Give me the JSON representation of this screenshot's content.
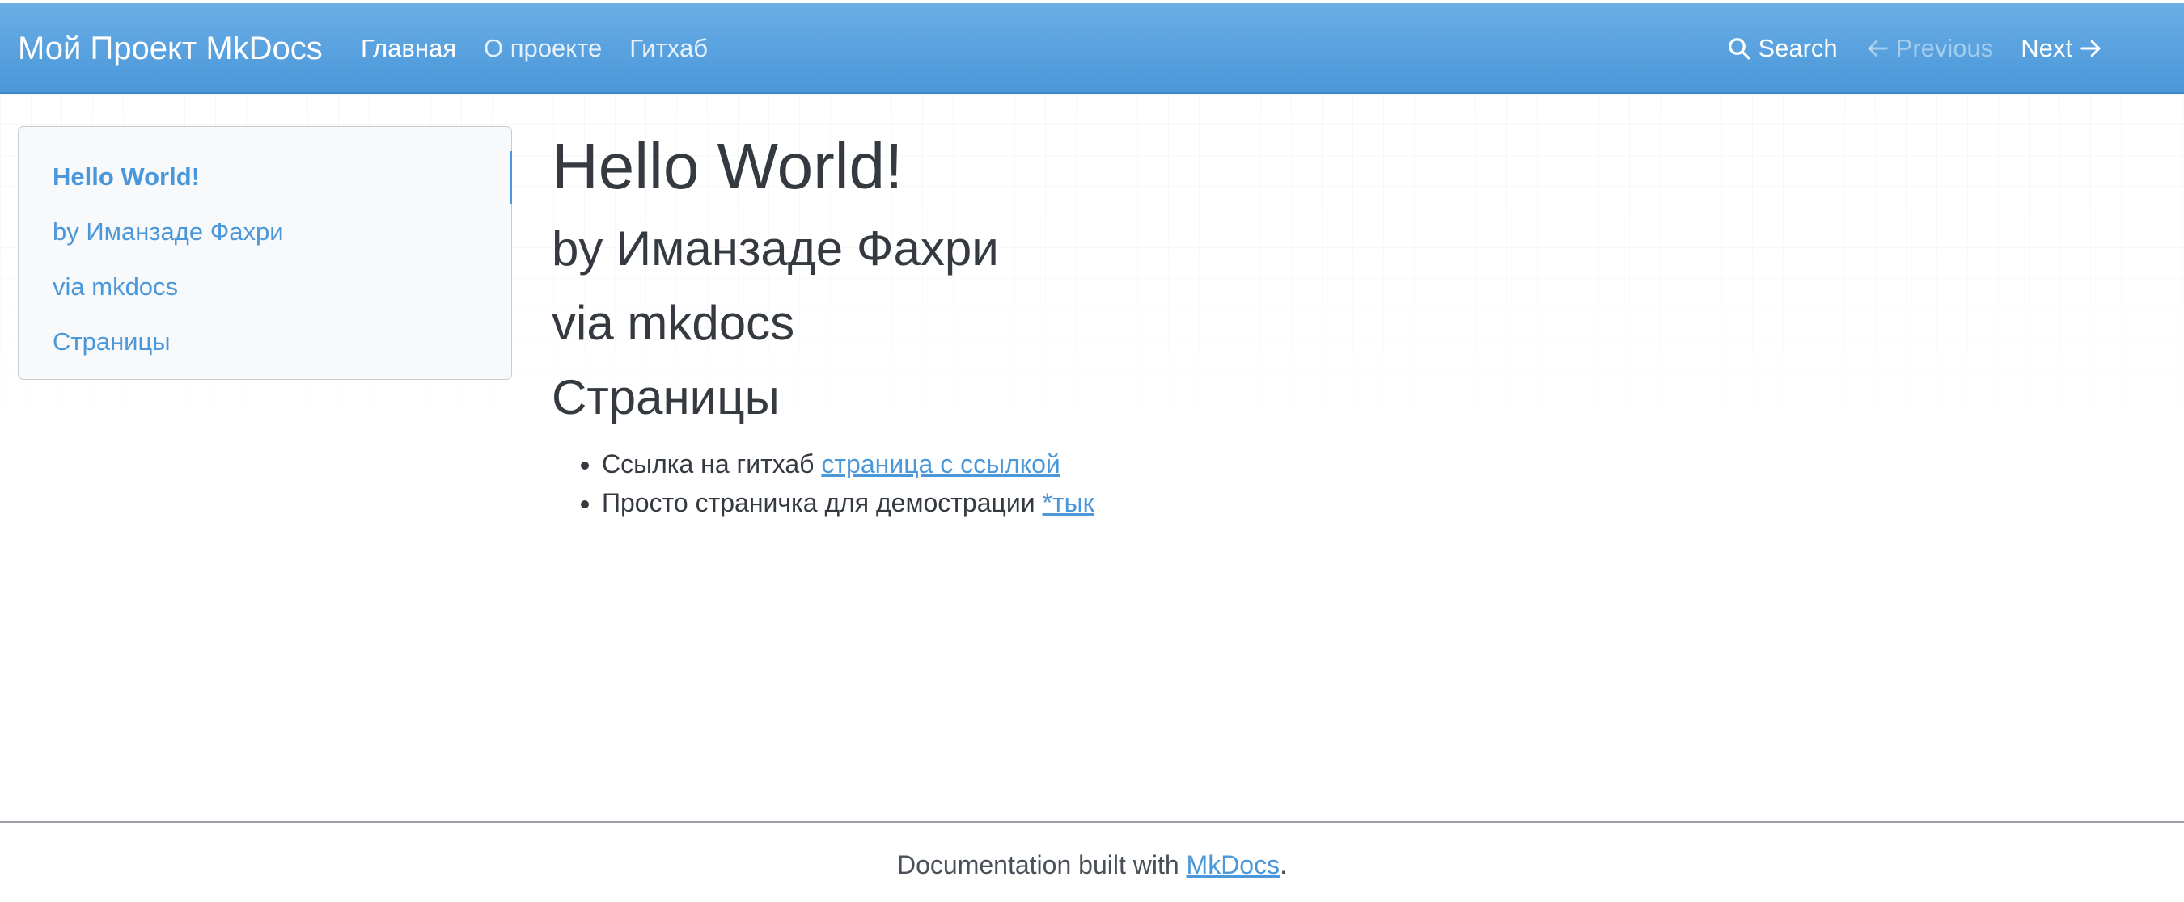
{
  "navbar": {
    "brand": "Мой Проект MkDocs",
    "links": [
      "Главная",
      "О проекте",
      "Гитхаб"
    ],
    "active_link_index": 0,
    "search_label": "Search",
    "previous_label": "Previous",
    "next_label": "Next",
    "search_icon": "search-icon",
    "previous_icon": "arrow-left-icon",
    "next_icon": "arrow-right-icon"
  },
  "sidebar": {
    "items": [
      {
        "label": "Hello World!",
        "active": true
      },
      {
        "label": "by Иманзаде Фахри",
        "active": false
      },
      {
        "label": "via mkdocs",
        "active": false
      },
      {
        "label": "Страницы",
        "active": false
      }
    ]
  },
  "content": {
    "title": "Hello World!",
    "author_heading": "by Иманзаде Фахри",
    "via_heading": "via mkdocs",
    "pages_heading": "Страницы",
    "list": [
      {
        "text": "Ссылка на гитхаб",
        "link": "страница с ссылкой"
      },
      {
        "text": "Просто страничка для демострации",
        "link": "*тык"
      }
    ]
  },
  "footer": {
    "prefix": "Documentation built with",
    "link": "MkDocs",
    "suffix": "."
  },
  "colors": {
    "navbar": "#4a97d9",
    "accent": "#4a97d9",
    "text": "#343a40"
  }
}
